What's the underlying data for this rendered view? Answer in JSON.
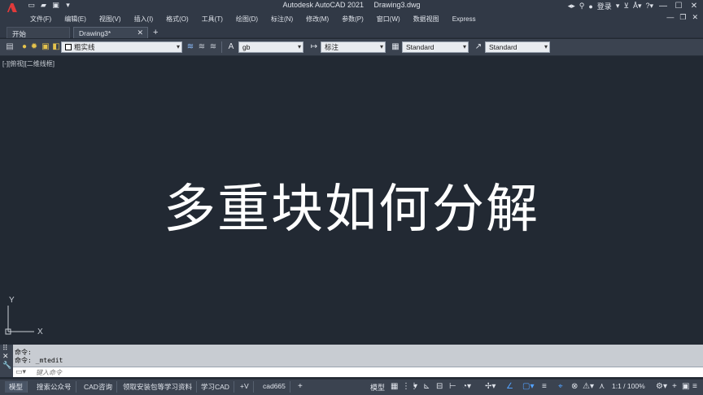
{
  "title": {
    "app_name": "Autodesk AutoCAD 2021",
    "file_name": "Drawing3.dwg",
    "login": "登录"
  },
  "menu": {
    "items": [
      "文件(F)",
      "编辑(E)",
      "视图(V)",
      "插入(I)",
      "格式(O)",
      "工具(T)",
      "绘图(D)",
      "标注(N)",
      "修改(M)",
      "参数(P)",
      "窗口(W)",
      "数据视图",
      "Express"
    ]
  },
  "tabs": {
    "start": "开始",
    "drawing": "Drawing3*"
  },
  "toolbar": {
    "layer": "粗实线",
    "text_style": "gb",
    "dim_style": "标注",
    "table_style": "Standard",
    "mleader_style": "Standard"
  },
  "canvas": {
    "viewport_label": "[-][俯视][二维线框]",
    "overlay_text": "多重块如何分解",
    "ucs_y": "Y",
    "ucs_x": "X"
  },
  "command": {
    "history_1": "命令:",
    "history_2": "命令: _mtedit",
    "placeholder": "键入命令"
  },
  "statusbar": {
    "layout_tabs": [
      "模型",
      "搜索公众号",
      "CAD咨询",
      "领取安装包等学习资料",
      "学习CAD",
      "+V",
      "cad665"
    ],
    "model_label": "模型",
    "scale": "1:1 / 100%"
  },
  "colors": {
    "canvas_bg": "#222933",
    "chrome_bg": "#313946",
    "logo_red": "#e03a3a",
    "accent_blue": "#53a2ff"
  }
}
